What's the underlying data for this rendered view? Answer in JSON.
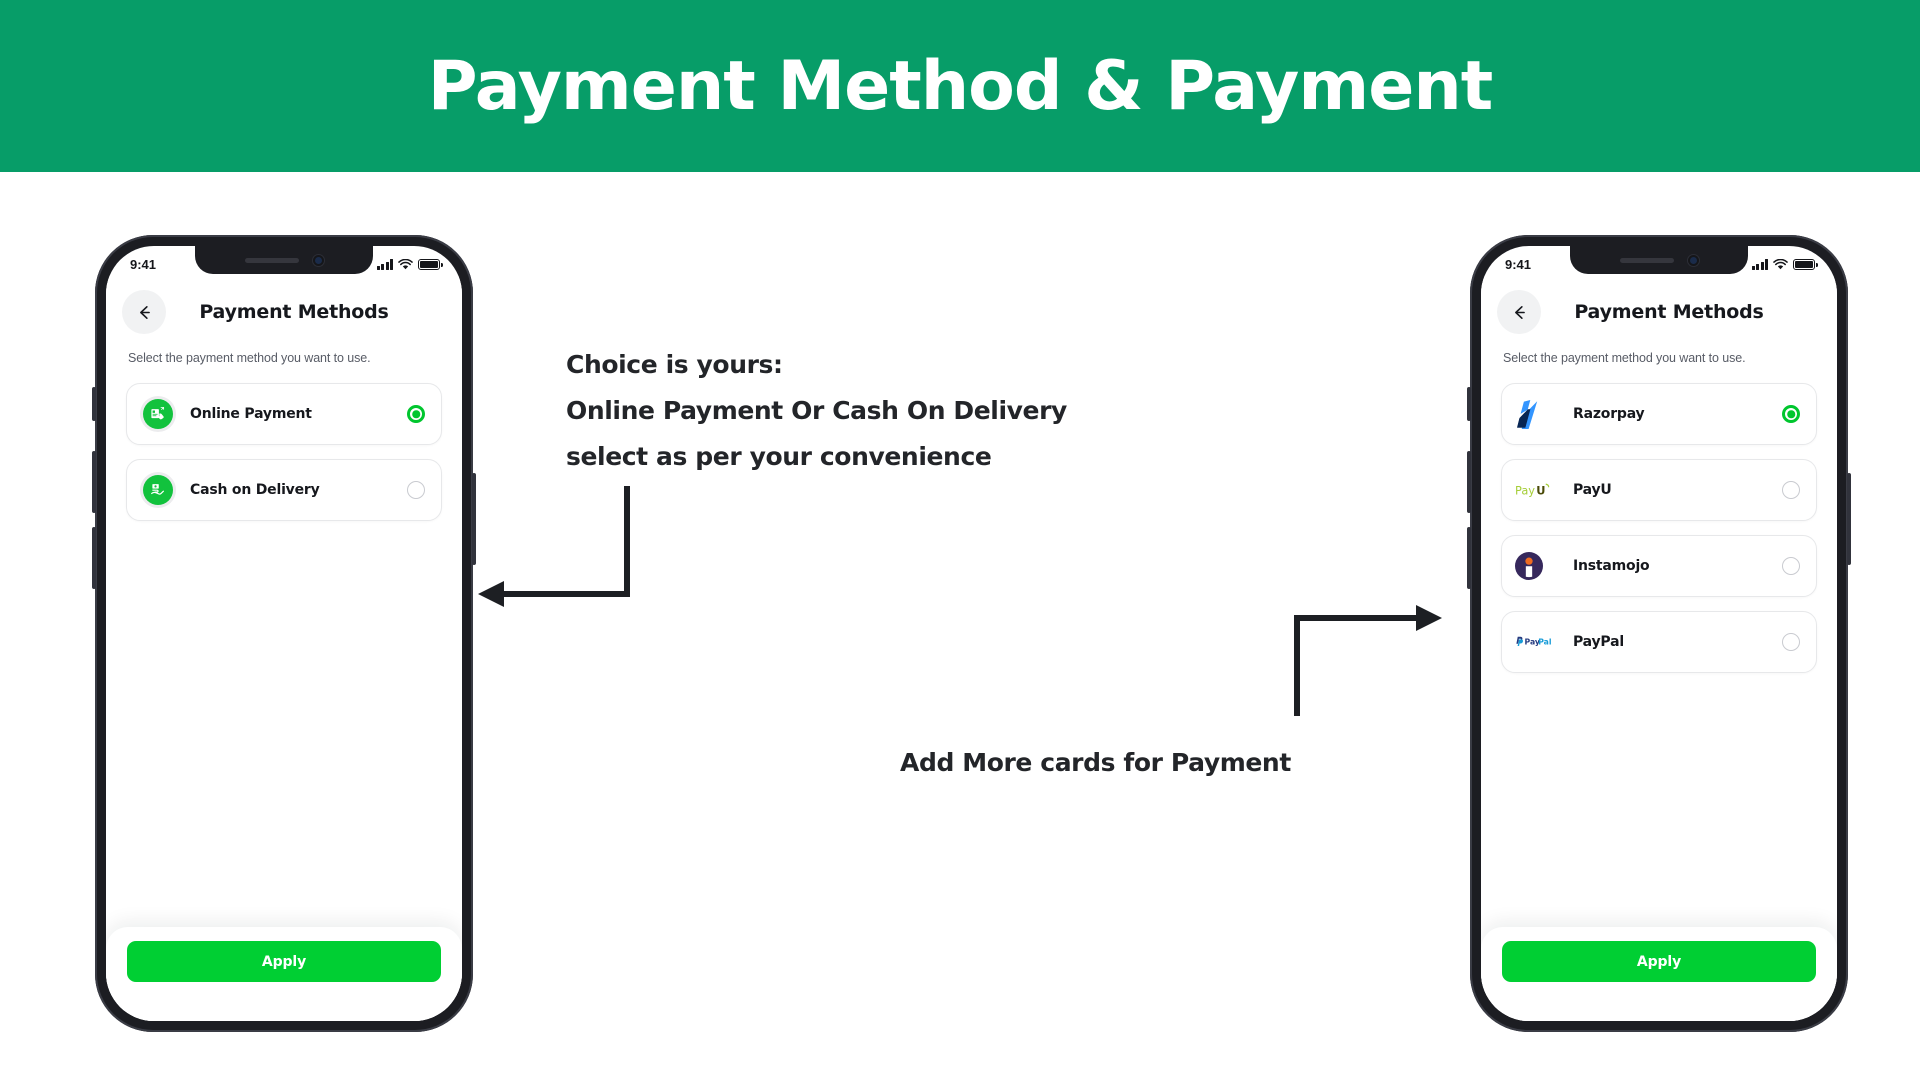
{
  "banner": {
    "title": "Payment Method & Payment",
    "bg_color": "#079d68",
    "text_color": "#ffffff"
  },
  "annotations": {
    "left": {
      "line1": "Choice is yours:",
      "line2": "Online Payment Or Cash On Delivery",
      "line3": "select as per your convenience"
    },
    "right": {
      "line1": "Add More cards for Payment"
    }
  },
  "phones": {
    "left": {
      "status_bar": {
        "time": "9:41",
        "signal": "cellular-bars-icon",
        "wifi": "wifi-icon",
        "battery": "battery-full-icon"
      },
      "appbar": {
        "back": "arrow-left-icon",
        "title": "Payment Methods"
      },
      "subtitle": "Select the payment method you want to use.",
      "options": [
        {
          "label": "Online Payment",
          "icon": "online-payment-icon",
          "icon_bg": "#12c23d",
          "selected": true
        },
        {
          "label": "Cash on Delivery",
          "icon": "cash-on-delivery-icon",
          "icon_bg": "#12c23d",
          "selected": false
        }
      ],
      "apply_label": "Apply",
      "apply_color": "#00cf33"
    },
    "right": {
      "status_bar": {
        "time": "9:41",
        "signal": "cellular-bars-icon",
        "wifi": "wifi-icon",
        "battery": "battery-full-icon"
      },
      "appbar": {
        "back": "arrow-left-icon",
        "title": "Payment Methods"
      },
      "subtitle": "Select the payment method you want to use.",
      "options": [
        {
          "label": "Razorpay",
          "icon": "razorpay-logo",
          "selected": true
        },
        {
          "label": "PayU",
          "icon": "payu-logo",
          "selected": false
        },
        {
          "label": "Instamojo",
          "icon": "instamojo-logo",
          "selected": false
        },
        {
          "label": "PayPal",
          "icon": "paypal-logo",
          "selected": false
        }
      ],
      "apply_label": "Apply",
      "apply_color": "#00cf33"
    }
  },
  "colors": {
    "banner_green": "#079d68",
    "accent_green": "#00cf33",
    "radio_on": "#00c62e",
    "text_dark": "#16181d",
    "text_muted": "#585c66",
    "razorpay_blue": "#3395ff",
    "razorpay_navy": "#072654",
    "payu_green": "#a6ce39",
    "payu_dark": "#4a4a08",
    "instamojo_navy": "#36285c",
    "instamojo_orange": "#ef6b21",
    "paypal_dark": "#253b80",
    "paypal_light": "#179bd7"
  }
}
